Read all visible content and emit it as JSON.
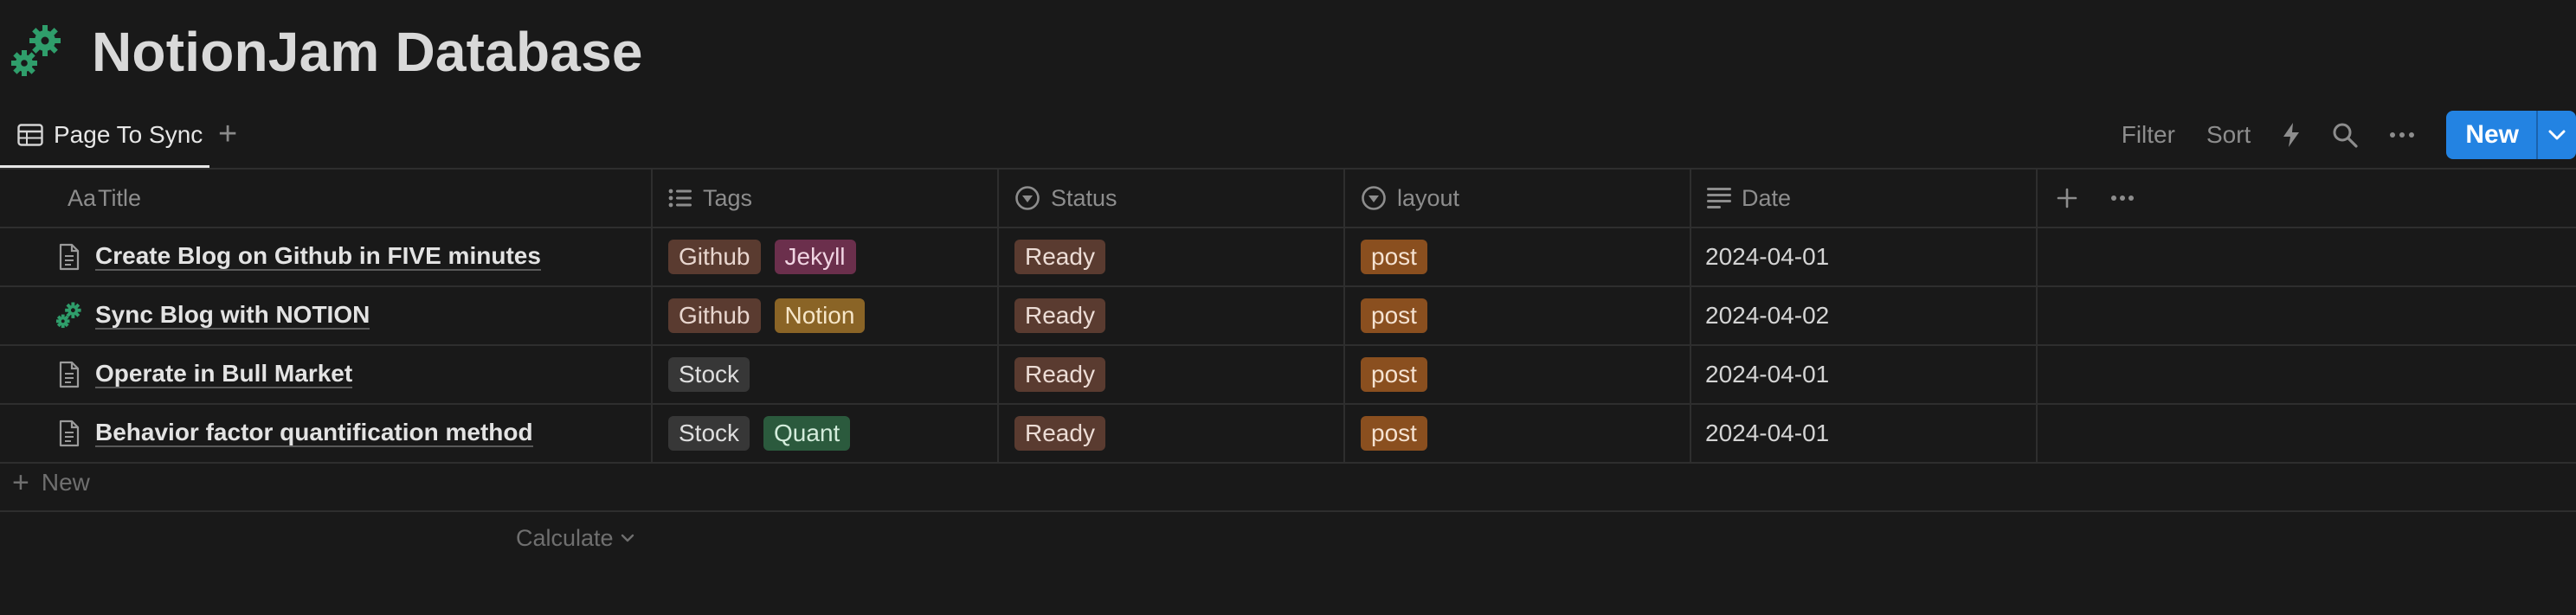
{
  "page": {
    "title": "NotionJam Database",
    "icon": "gears-icon"
  },
  "views": {
    "active_tab": "Page To Sync",
    "add_symbol": "+"
  },
  "toolbar": {
    "filter": "Filter",
    "sort": "Sort",
    "new_label": "New"
  },
  "columns": {
    "title_prefix": "Aa",
    "title": "Title",
    "tags": "Tags",
    "status": "Status",
    "layout": "layout",
    "date": "Date",
    "add_symbol": "+"
  },
  "rows": [
    {
      "title": "Create Blog on Github in FIVE minutes",
      "icon": "document-icon",
      "tags": [
        "Github",
        "Jekyll"
      ],
      "status": "Ready",
      "layout": "post",
      "date": "2024-04-01"
    },
    {
      "title": "Sync Blog with NOTION",
      "icon": "gears-icon",
      "tags": [
        "Github",
        "Notion"
      ],
      "status": "Ready",
      "layout": "post",
      "date": "2024-04-02"
    },
    {
      "title": "Operate in Bull Market",
      "icon": "document-icon",
      "tags": [
        "Stock"
      ],
      "status": "Ready",
      "layout": "post",
      "date": "2024-04-01"
    },
    {
      "title": "Behavior factor quantification method",
      "icon": "document-icon",
      "tags": [
        "Stock",
        "Quant"
      ],
      "status": "Ready",
      "layout": "post",
      "date": "2024-04-01"
    }
  ],
  "footer": {
    "new_row": "New",
    "new_symbol": "+",
    "calculate": "Calculate"
  },
  "colors": {
    "background": "#191919",
    "accent": "#2383e2",
    "tag_github": "#5a3b30",
    "tag_jekyll": "#6b2f4c",
    "tag_notion": "#8a6426",
    "tag_stock": "#373737",
    "tag_quant": "#2b5a3d",
    "status_ready": "#5a3b30",
    "layout_post": "#8a4f1f"
  }
}
